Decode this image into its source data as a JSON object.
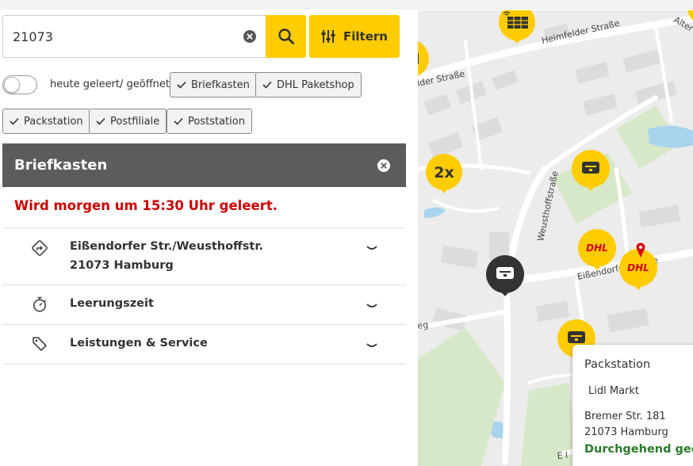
{
  "search": {
    "value": "21073"
  },
  "filter_button": {
    "label": "Filtern"
  },
  "toggle": {
    "label": "heute geleert/ geöffnet",
    "on": false
  },
  "chips": [
    {
      "label": "Briefkasten"
    },
    {
      "label": "DHL Paketshop"
    },
    {
      "label": "Packstation"
    },
    {
      "label": "Postfiliale"
    },
    {
      "label": "Poststation"
    }
  ],
  "panel": {
    "title": "Briefkasten",
    "alert": "Wird morgen um 15:30 Uhr geleert.",
    "address_line1": "Eißendorfer Str./Weusthoffstr.",
    "address_line2": "21073 Hamburg",
    "sections": [
      {
        "label": "Leerungszeit",
        "icon": "stopwatch-icon"
      },
      {
        "label": "Leistungen & Service",
        "icon": "tag-icon"
      }
    ]
  },
  "map": {
    "streets": [
      "Heimfelder Straße",
      "Weusthoffstraße",
      "Eißendorfer Straße",
      "Alter",
      "lder Straße",
      "eg",
      "E l"
    ],
    "cluster_label": "2x",
    "dhl_label": "DHL",
    "popup": {
      "title": "Packstation",
      "name": "Lidl Markt",
      "address1": "Bremer Str. 181",
      "address2": "21073 Hamburg",
      "status": "Durchgehend geöffnet"
    }
  },
  "colors": {
    "accent": "#ffcc00",
    "panel_header": "#5c5c5c",
    "alert": "#cc0000",
    "status_open": "#2a7a2a",
    "dhl_red": "#d40511"
  }
}
